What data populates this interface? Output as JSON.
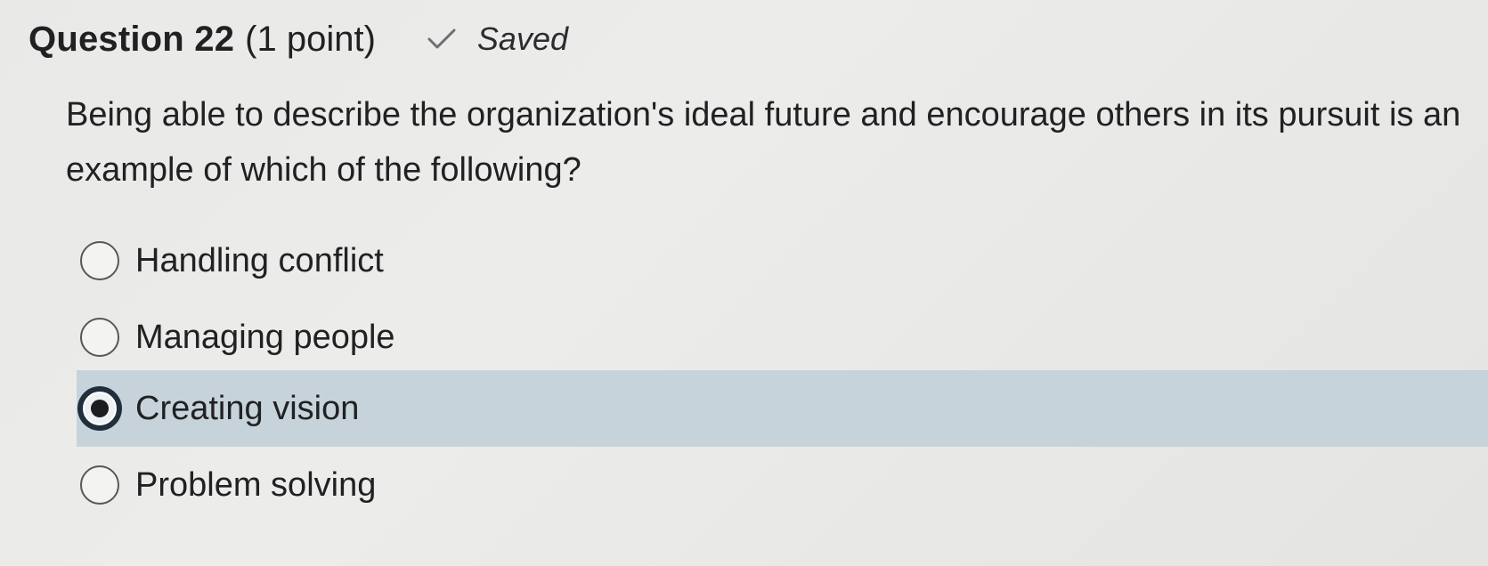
{
  "header": {
    "title": "Question 22",
    "points": "(1 point)",
    "status_icon": "check-icon",
    "status_label": "Saved"
  },
  "question": {
    "text": "Being able to describe the organization's ideal future and encourage others in its pursuit is an example of which of the following?"
  },
  "options": [
    {
      "label": "Handling conflict",
      "selected": false
    },
    {
      "label": "Managing people",
      "selected": false
    },
    {
      "label": "Creating vision",
      "selected": true
    },
    {
      "label": "Problem solving",
      "selected": false
    }
  ],
  "colors": {
    "selected_row": "#c7d3db",
    "text": "#202122"
  }
}
